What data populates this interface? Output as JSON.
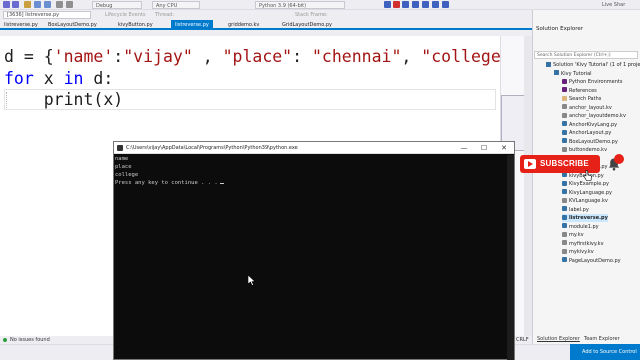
{
  "toolbar": {
    "debug_config": "Debug",
    "platform": "Any CPU",
    "python_env": "Python 3.9 (64-bit)",
    "live_share": "Live Shar"
  },
  "process_bar": {
    "process": "[3636] listreverse.py",
    "lifecycle": "Lifecycle Events",
    "thread": "Thread:",
    "stack_frame": "Stack Frame:"
  },
  "tabs": [
    {
      "label": "listreverse.py"
    },
    {
      "label": "BoxLayoutDemo.py"
    },
    {
      "label": "kivyButton.py"
    },
    {
      "label": "listreverse.py"
    },
    {
      "label": "griddemo.kv"
    },
    {
      "label": "GridLayoutDemo.py"
    }
  ],
  "editor": {
    "line1_var": "d = {",
    "line1_k1": "'name'",
    "line1_colon1": ":",
    "line1_v1": "\"vijay\"",
    "line1_sep1": " , ",
    "line1_k2": "\"place\"",
    "line1_colon2": ": ",
    "line1_v2": "\"chennai\"",
    "line1_sep2": ", ",
    "line1_k3": "\"college",
    "line2_for": "for",
    "line2_x": " x ",
    "line2_in": "in",
    "line2_rest": " d:",
    "line3": "    print(x)"
  },
  "status": {
    "issues": "No issues found",
    "crlf": "CRLF"
  },
  "console": {
    "title": "C:\\Users\\vijay\\AppData\\Local\\Programs\\Python\\Python39\\python.exe",
    "minimize": "—",
    "maximize": "☐",
    "close": "✕",
    "lines": [
      "name",
      "place",
      "college",
      "Press any key to continue . . ."
    ]
  },
  "solution_explorer": {
    "title": "Solution Explorer",
    "search_placeholder": "Search Solution Explorer (Ctrl+;)",
    "items": [
      {
        "label": "Solution 'Kivy Tutorial' (1 of 1 projec",
        "icon": "solution"
      },
      {
        "label": "Kivy Tutorial",
        "icon": "project"
      },
      {
        "label": "Python Environments",
        "icon": "ref"
      },
      {
        "label": "References",
        "icon": "ref"
      },
      {
        "label": "Search Paths",
        "icon": "folder"
      },
      {
        "label": "anchor_layout.kv",
        "icon": "kv"
      },
      {
        "label": "anchor_layoutdemo.kv",
        "icon": "kv"
      },
      {
        "label": "AnchorKivyLang.py",
        "icon": "py"
      },
      {
        "label": "AnchorLayout.py",
        "icon": "py"
      },
      {
        "label": "BoxLayoutDemo.py",
        "icon": "py"
      },
      {
        "label": "buttondemo.kv",
        "icon": "kv"
      },
      {
        "label": "kivy_tutorial",
        "icon": "py"
      },
      {
        "label": "kivy_tutorial.py",
        "icon": "py"
      },
      {
        "label": "kivyButton.py",
        "icon": "py"
      },
      {
        "label": "KivyExample.py",
        "icon": "py"
      },
      {
        "label": "KivyLanguage.py",
        "icon": "py"
      },
      {
        "label": "KVLanguage.kv",
        "icon": "kv"
      },
      {
        "label": "label.py",
        "icon": "py"
      },
      {
        "label": "listreverse.py",
        "icon": "py"
      },
      {
        "label": "module1.py",
        "icon": "py"
      },
      {
        "label": "my.kv",
        "icon": "kv"
      },
      {
        "label": "myfirstkivy.kv",
        "icon": "kv"
      },
      {
        "label": "mykivy.kv",
        "icon": "kv"
      },
      {
        "label": "PageLayoutDemo.py",
        "icon": "py"
      }
    ],
    "bottom_tabs": [
      "Solution Explorer",
      "Team Explorer"
    ]
  },
  "source_control": "Add to Source Control",
  "overlay": {
    "subscribe": "SUBSCRIBE"
  },
  "colors": {
    "accent": "#007acc",
    "subscribe_red": "#e62117",
    "keyword": "#0000ff",
    "string": "#a31515",
    "console_bg": "#0c0c0c"
  }
}
